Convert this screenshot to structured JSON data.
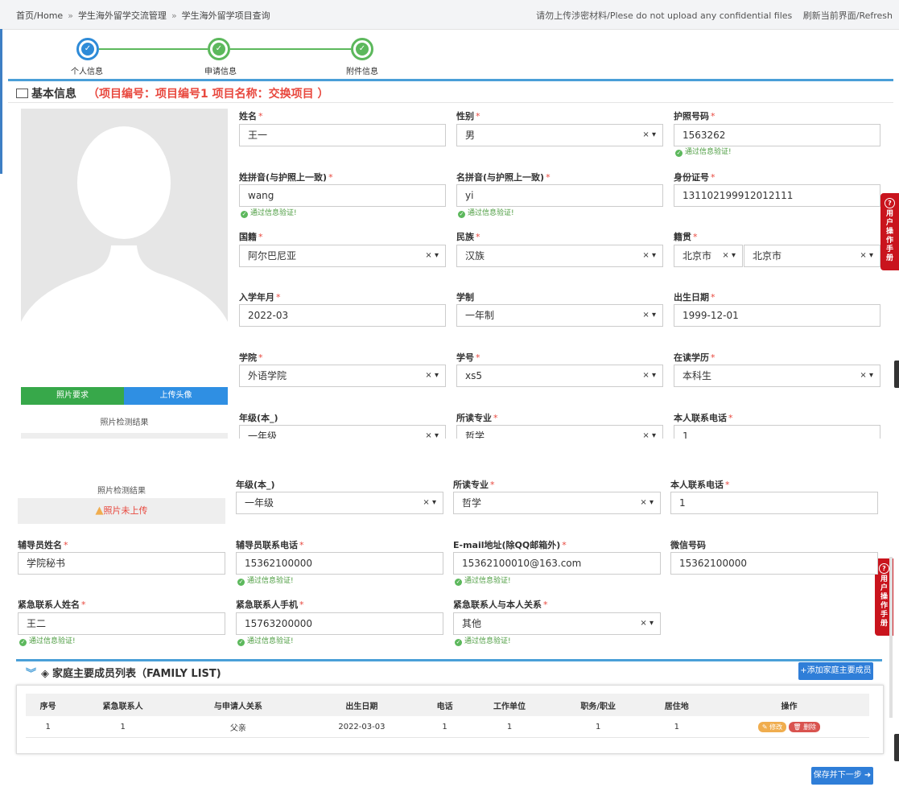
{
  "breadcrumb": {
    "home": "首页/Home",
    "sep": "»",
    "level1": "学生海外留学交流管理",
    "level2": "学生海外留学项目查询",
    "notice": "请勿上传涉密材料/Plese do not upload any confidential files",
    "refresh": "刷新当前界面/Refresh"
  },
  "steps": [
    {
      "label": "个人信息",
      "color": "#2e8bd8"
    },
    {
      "label": "申请信息",
      "color": "#5cb85c"
    },
    {
      "label": "附件信息",
      "color": "#5cb85c"
    }
  ],
  "section": {
    "title": "基本信息",
    "project": "（项目编号：项目编号1 项目名称：交换项目 ）"
  },
  "photo": {
    "req_btn": "照片要求",
    "upload_btn": "上传头像",
    "check_title": "照片检测结果",
    "warn_text": "照片未上传"
  },
  "form": {
    "name": {
      "label": "姓名",
      "value": "王一"
    },
    "gender": {
      "label": "性别",
      "value": "男"
    },
    "passport": {
      "label": "护照号码",
      "value": "1563262"
    },
    "surname_py": {
      "label": "姓拼音(与护照上一致)",
      "value": "wang"
    },
    "given_py": {
      "label": "名拼音(与护照上一致)",
      "value": "yi"
    },
    "id_no": {
      "label": "身份证号",
      "value": "131102199912012111"
    },
    "nationality": {
      "label": "国籍",
      "value": "阿尔巴尼亚"
    },
    "ethnicity": {
      "label": "民族",
      "value": "汉族"
    },
    "origin": {
      "label": "籍贯",
      "value1": "北京市",
      "value2": "北京市"
    },
    "enroll": {
      "label": "入学年月",
      "value": "2022-03"
    },
    "duration": {
      "label": "学制",
      "value": "一年制"
    },
    "birth": {
      "label": "出生日期",
      "value": "1999-12-01"
    },
    "college": {
      "label": "学院",
      "value": "外语学院"
    },
    "student_no": {
      "label": "学号",
      "value": "xs5"
    },
    "degree": {
      "label": "在读学历",
      "value": "本科生"
    },
    "grade": {
      "label": "年级(本_)",
      "value": "一年级"
    },
    "major": {
      "label": "所读专业",
      "value": "哲学"
    },
    "phone": {
      "label": "本人联系电话",
      "value": "1"
    },
    "counselor": {
      "label": "辅导员姓名",
      "value": "学院秘书"
    },
    "counselor_phone": {
      "label": "辅导员联系电话",
      "value": "15362100000"
    },
    "email": {
      "label": "E-mail地址(除QQ邮箱外)",
      "value": "15362100010@163.com"
    },
    "wechat": {
      "label": "微信号码",
      "value": "15362100000"
    },
    "emerg_name": {
      "label": "紧急联系人姓名",
      "value": "王二"
    },
    "emerg_phone": {
      "label": "紧急联系人手机",
      "value": "15763200000"
    },
    "emerg_rel": {
      "label": "紧急联系人与本人关系",
      "value": "其他"
    }
  },
  "verified_text": "通过信息验证!",
  "select_ctl": "× ▾",
  "help": {
    "text": "用户操作手册"
  },
  "family": {
    "title": "家庭主要成员列表（FAMILY LIST)",
    "add_btn": "+添加家庭主要成员",
    "columns": [
      "序号",
      "紧急联系人",
      "与申请人关系",
      "出生日期",
      "电话",
      "工作单位",
      "职务/职业",
      "居住地",
      "操作"
    ],
    "rows": [
      [
        "1",
        "1",
        "父亲",
        "2022-03-03",
        "1",
        "1",
        "1",
        "1"
      ]
    ],
    "edit": "修改",
    "delete": "删除"
  },
  "save_btn": "保存并下一步 ➜"
}
